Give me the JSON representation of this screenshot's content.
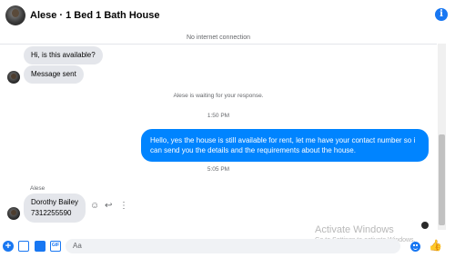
{
  "header": {
    "title": "Alese · 1 Bed 1 Bath House",
    "info_glyph": "i"
  },
  "status": {
    "no_connection": "No internet connection"
  },
  "messages": {
    "incoming_1": "Hi, is this available?",
    "incoming_2": "Message sent",
    "waiting_note": "Alese is waiting for your response.",
    "time_1": "1:50 PM",
    "outgoing_1": "Hello, yes the house is still available for rent, let me have your contact number so i can send you the details and the requirements about the house.",
    "time_2": "5:05 PM",
    "sender_name": "Alese",
    "incoming_3_line1": "Dorothy Bailey",
    "incoming_3_line2": "7312255590"
  },
  "message_actions": {
    "react_glyph": "☺",
    "reply_glyph": "↩",
    "more_glyph": "⋮"
  },
  "watermark": {
    "title": "Activate Windows",
    "subtitle": "Go to Settings to activate Windows."
  },
  "composer": {
    "plus_glyph": "+",
    "gif_label": "GIF",
    "placeholder": "Aa",
    "like_glyph": "👍"
  },
  "icons": {
    "header": [
      "avatar",
      "info-icon"
    ],
    "composer": [
      "plus-icon",
      "photo-icon",
      "sticker-icon",
      "gif-icon",
      "emoji-icon",
      "like-icon"
    ]
  },
  "colors": {
    "accent": "#1877f2",
    "outgoing_bubble": "#0084ff",
    "incoming_bubble": "#e4e6eb"
  }
}
